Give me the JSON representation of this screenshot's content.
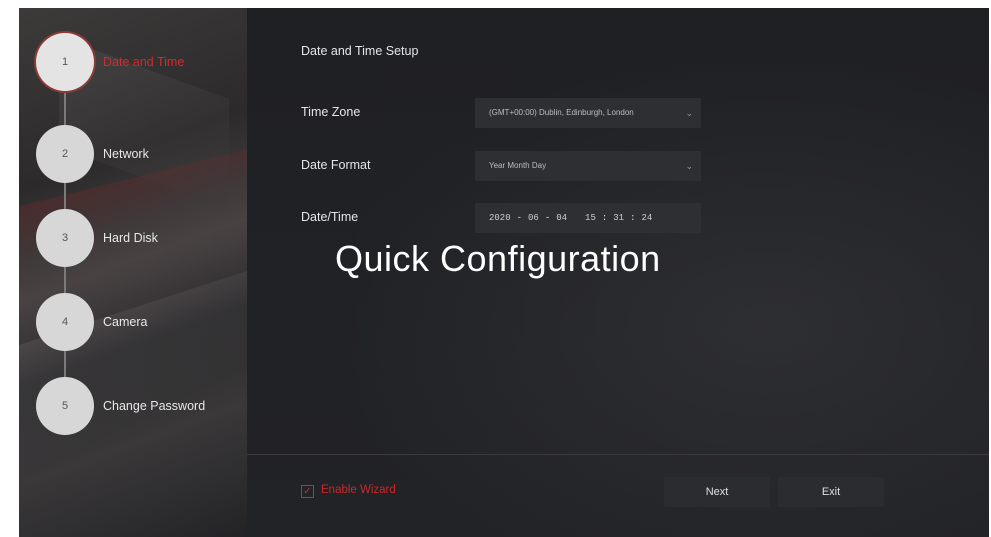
{
  "wizard": {
    "steps": [
      {
        "number": "1",
        "label": "Date and Time",
        "active": true
      },
      {
        "number": "2",
        "label": "Network",
        "active": false
      },
      {
        "number": "3",
        "label": "Hard Disk",
        "active": false
      },
      {
        "number": "4",
        "label": "Camera",
        "active": false
      },
      {
        "number": "5",
        "label": "Change Password",
        "active": false
      }
    ]
  },
  "main": {
    "section_title": "Date and Time Setup",
    "time_zone": {
      "label": "Time Zone",
      "value": "(GMT+00:00) Dublin, Edinburgh, London"
    },
    "date_format": {
      "label": "Date Format",
      "value": "Year Month Day"
    },
    "date_time": {
      "label": "Date/Time",
      "year": "2020",
      "month": "06",
      "day": "04",
      "hour": "15",
      "minute": "31",
      "second": "24"
    },
    "overlay_title": "Quick Configuration"
  },
  "footer": {
    "enable_wizard_label": "Enable Wizard",
    "enable_wizard_checked": true,
    "next_label": "Next",
    "exit_label": "Exit"
  },
  "colors": {
    "accent_red": "#d22b2b",
    "background": "#1f2024"
  },
  "icons": [
    "checkbox-checked-icon",
    "chevron-down-icon"
  ]
}
